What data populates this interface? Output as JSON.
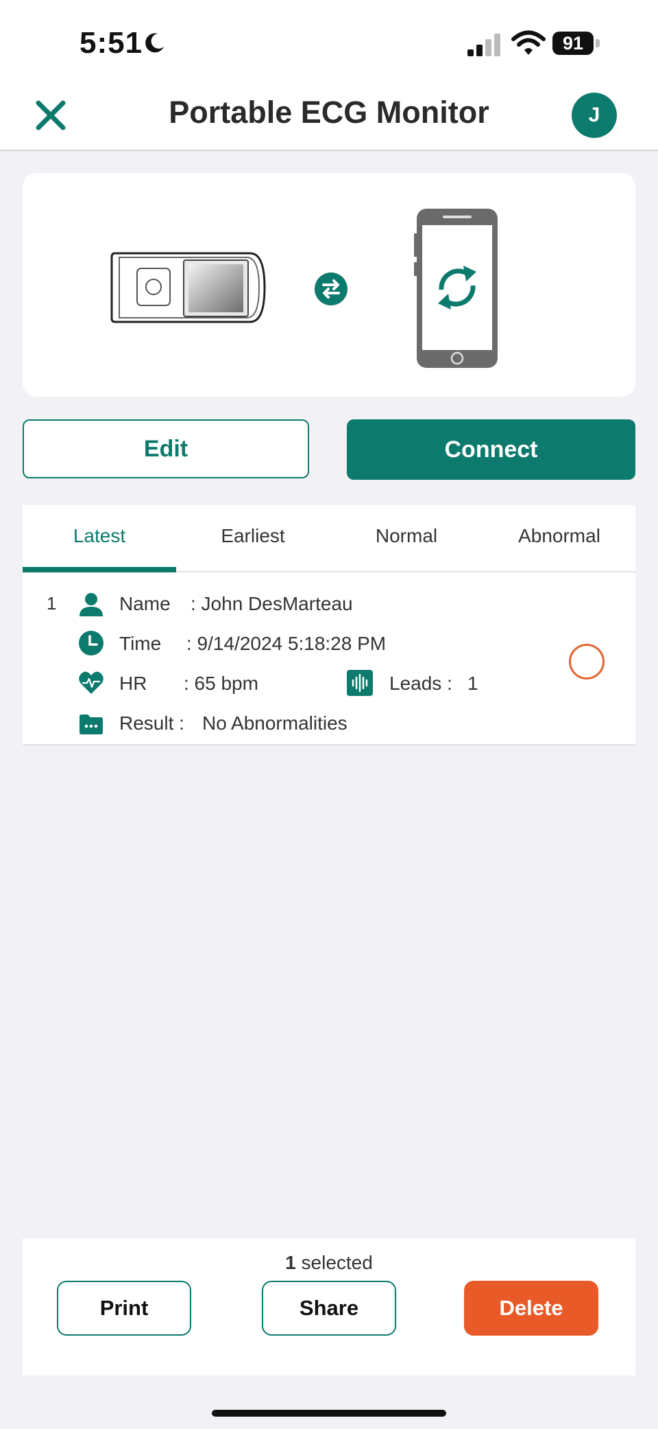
{
  "status_bar": {
    "time": "5:51",
    "battery": "91"
  },
  "header": {
    "title": "Portable ECG Monitor",
    "avatar_initial": "J"
  },
  "actions": {
    "edit_label": "Edit",
    "connect_label": "Connect"
  },
  "tabs": [
    {
      "label": "Latest",
      "active": true
    },
    {
      "label": "Earliest",
      "active": false
    },
    {
      "label": "Normal",
      "active": false
    },
    {
      "label": "Abnormal",
      "active": false
    }
  ],
  "records": [
    {
      "index": "1",
      "name_label": "Name",
      "name_value": ":  John DesMarteau",
      "time_label": "Time",
      "time_value": ":  9/14/2024  5:18:28 PM",
      "hr_label": "HR",
      "hr_value": ":  65 bpm",
      "leads_label": "Leads :",
      "leads_value": "1",
      "result_label": "Result :",
      "result_value": "No Abnormalities"
    }
  ],
  "bottom_bar": {
    "selected_count": "1",
    "selected_text": "selected",
    "print_label": "Print",
    "share_label": "Share",
    "delete_label": "Delete"
  },
  "colors": {
    "brand": "#0c7a6c",
    "danger": "#e85b28",
    "select_ring": "#e2632f"
  }
}
